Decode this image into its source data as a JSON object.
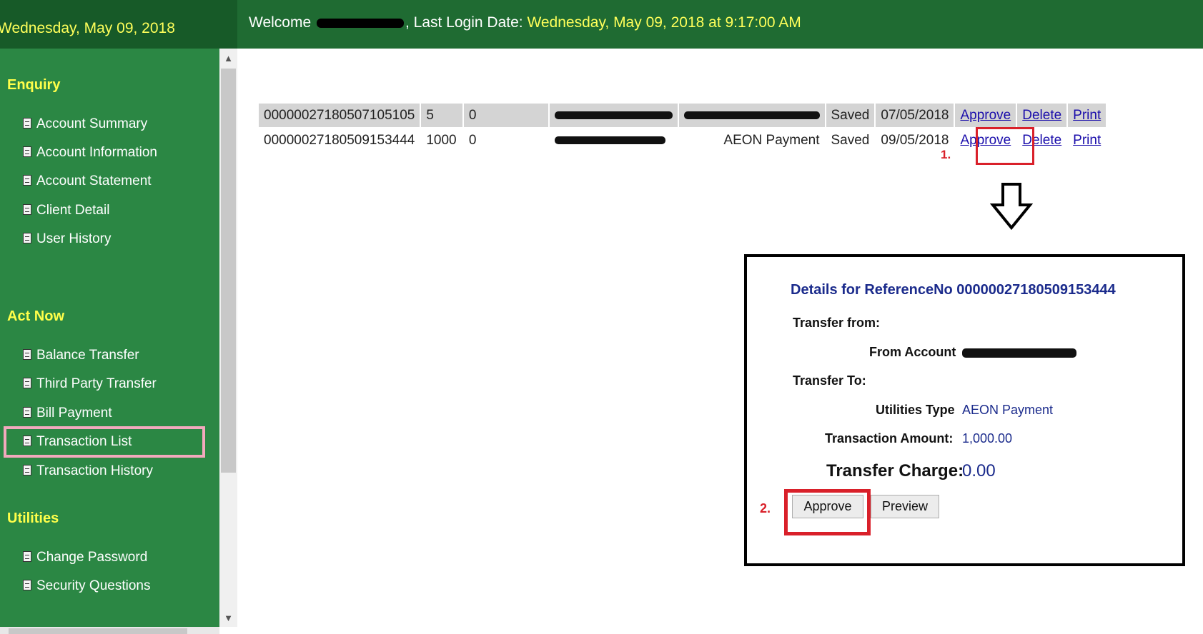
{
  "header": {
    "date": "Wednesday, May 09, 2018",
    "welcome_prefix": "Welcome",
    "last_login_label": ", Last Login Date:",
    "last_login_value": "Wednesday, May 09, 2018 at 9:17:00 AM"
  },
  "sidebar": {
    "sections": [
      {
        "title": "Enquiry",
        "items": [
          "Account Summary",
          "Account Information",
          "Account Statement",
          "Client Detail",
          "User History"
        ]
      },
      {
        "title": "Act Now",
        "items": [
          "Balance Transfer",
          "Third Party Transfer",
          "Bill Payment",
          "Transaction List",
          "Transaction History"
        ]
      },
      {
        "title": "Utilities",
        "items": [
          "Change Password",
          "Security Questions"
        ]
      }
    ],
    "highlighted_item": "Transaction List"
  },
  "transactions": [
    {
      "ref": "00000027180507105105",
      "amount": "5",
      "charge": "0",
      "description": "",
      "status": "Saved",
      "date": "07/05/2018",
      "actions": [
        "Approve",
        "Delete",
        "Print"
      ]
    },
    {
      "ref": "00000027180509153444",
      "amount": "1000",
      "charge": "0",
      "description": "AEON Payment",
      "status": "Saved",
      "date": "09/05/2018",
      "actions": [
        "Approve",
        "Delete",
        "Print"
      ]
    }
  ],
  "annotations": {
    "step1": "1.",
    "step2": "2."
  },
  "details": {
    "title": "Details for ReferenceNo 00000027180509153444",
    "transfer_from_label": "Transfer from:",
    "from_account_label": "From Account",
    "transfer_to_label": "Transfer To:",
    "utilities_type_label": "Utilities Type",
    "utilities_type_value": "AEON Payment",
    "amount_label": "Transaction Amount:",
    "amount_value": "1,000.00",
    "charge_label": "Transfer Charge:",
    "charge_value": "0.00",
    "approve_button": "Approve",
    "preview_button": "Preview"
  },
  "colors": {
    "header_green": "#1f6b32",
    "sidebar_green": "#2b8744",
    "heading_yellow": "#ffff4a",
    "annotation_red": "#d9202a",
    "highlight_pink": "#f2a9bd",
    "detail_blue": "#1b2b8c"
  }
}
